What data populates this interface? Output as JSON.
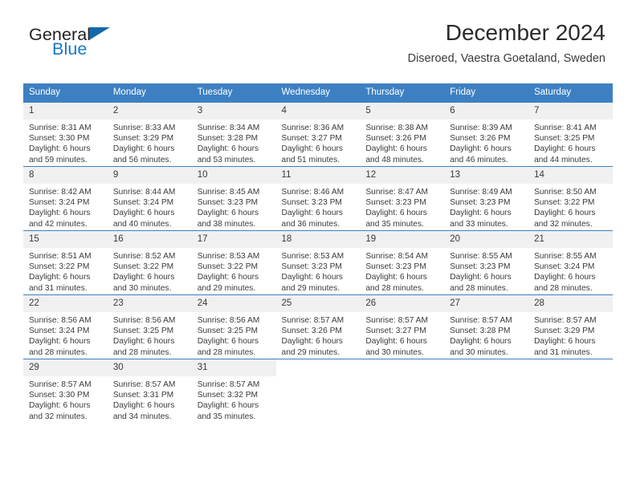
{
  "brand": {
    "name_part1": "General",
    "name_part2": "Blue",
    "triangle_icon": "triangle-icon",
    "accent_color": "#1368ad"
  },
  "header": {
    "title": "December 2024",
    "subtitle": "Diseroed, Vaestra Goetaland, Sweden"
  },
  "theme": {
    "header_bg": "#3d80c2",
    "daynum_bg": "#f0f0f0",
    "text_color": "#3a3a3a",
    "border_color": "#3d80c2"
  },
  "calendar": {
    "weekday_headers": [
      "Sunday",
      "Monday",
      "Tuesday",
      "Wednesday",
      "Thursday",
      "Friday",
      "Saturday"
    ],
    "weeks": [
      [
        {
          "day": "1",
          "sunrise": "Sunrise: 8:31 AM",
          "sunset": "Sunset: 3:30 PM",
          "daylight1": "Daylight: 6 hours",
          "daylight2": "and 59 minutes."
        },
        {
          "day": "2",
          "sunrise": "Sunrise: 8:33 AM",
          "sunset": "Sunset: 3:29 PM",
          "daylight1": "Daylight: 6 hours",
          "daylight2": "and 56 minutes."
        },
        {
          "day": "3",
          "sunrise": "Sunrise: 8:34 AM",
          "sunset": "Sunset: 3:28 PM",
          "daylight1": "Daylight: 6 hours",
          "daylight2": "and 53 minutes."
        },
        {
          "day": "4",
          "sunrise": "Sunrise: 8:36 AM",
          "sunset": "Sunset: 3:27 PM",
          "daylight1": "Daylight: 6 hours",
          "daylight2": "and 51 minutes."
        },
        {
          "day": "5",
          "sunrise": "Sunrise: 8:38 AM",
          "sunset": "Sunset: 3:26 PM",
          "daylight1": "Daylight: 6 hours",
          "daylight2": "and 48 minutes."
        },
        {
          "day": "6",
          "sunrise": "Sunrise: 8:39 AM",
          "sunset": "Sunset: 3:26 PM",
          "daylight1": "Daylight: 6 hours",
          "daylight2": "and 46 minutes."
        },
        {
          "day": "7",
          "sunrise": "Sunrise: 8:41 AM",
          "sunset": "Sunset: 3:25 PM",
          "daylight1": "Daylight: 6 hours",
          "daylight2": "and 44 minutes."
        }
      ],
      [
        {
          "day": "8",
          "sunrise": "Sunrise: 8:42 AM",
          "sunset": "Sunset: 3:24 PM",
          "daylight1": "Daylight: 6 hours",
          "daylight2": "and 42 minutes."
        },
        {
          "day": "9",
          "sunrise": "Sunrise: 8:44 AM",
          "sunset": "Sunset: 3:24 PM",
          "daylight1": "Daylight: 6 hours",
          "daylight2": "and 40 minutes."
        },
        {
          "day": "10",
          "sunrise": "Sunrise: 8:45 AM",
          "sunset": "Sunset: 3:23 PM",
          "daylight1": "Daylight: 6 hours",
          "daylight2": "and 38 minutes."
        },
        {
          "day": "11",
          "sunrise": "Sunrise: 8:46 AM",
          "sunset": "Sunset: 3:23 PM",
          "daylight1": "Daylight: 6 hours",
          "daylight2": "and 36 minutes."
        },
        {
          "day": "12",
          "sunrise": "Sunrise: 8:47 AM",
          "sunset": "Sunset: 3:23 PM",
          "daylight1": "Daylight: 6 hours",
          "daylight2": "and 35 minutes."
        },
        {
          "day": "13",
          "sunrise": "Sunrise: 8:49 AM",
          "sunset": "Sunset: 3:23 PM",
          "daylight1": "Daylight: 6 hours",
          "daylight2": "and 33 minutes."
        },
        {
          "day": "14",
          "sunrise": "Sunrise: 8:50 AM",
          "sunset": "Sunset: 3:22 PM",
          "daylight1": "Daylight: 6 hours",
          "daylight2": "and 32 minutes."
        }
      ],
      [
        {
          "day": "15",
          "sunrise": "Sunrise: 8:51 AM",
          "sunset": "Sunset: 3:22 PM",
          "daylight1": "Daylight: 6 hours",
          "daylight2": "and 31 minutes."
        },
        {
          "day": "16",
          "sunrise": "Sunrise: 8:52 AM",
          "sunset": "Sunset: 3:22 PM",
          "daylight1": "Daylight: 6 hours",
          "daylight2": "and 30 minutes."
        },
        {
          "day": "17",
          "sunrise": "Sunrise: 8:53 AM",
          "sunset": "Sunset: 3:22 PM",
          "daylight1": "Daylight: 6 hours",
          "daylight2": "and 29 minutes."
        },
        {
          "day": "18",
          "sunrise": "Sunrise: 8:53 AM",
          "sunset": "Sunset: 3:23 PM",
          "daylight1": "Daylight: 6 hours",
          "daylight2": "and 29 minutes."
        },
        {
          "day": "19",
          "sunrise": "Sunrise: 8:54 AM",
          "sunset": "Sunset: 3:23 PM",
          "daylight1": "Daylight: 6 hours",
          "daylight2": "and 28 minutes."
        },
        {
          "day": "20",
          "sunrise": "Sunrise: 8:55 AM",
          "sunset": "Sunset: 3:23 PM",
          "daylight1": "Daylight: 6 hours",
          "daylight2": "and 28 minutes."
        },
        {
          "day": "21",
          "sunrise": "Sunrise: 8:55 AM",
          "sunset": "Sunset: 3:24 PM",
          "daylight1": "Daylight: 6 hours",
          "daylight2": "and 28 minutes."
        }
      ],
      [
        {
          "day": "22",
          "sunrise": "Sunrise: 8:56 AM",
          "sunset": "Sunset: 3:24 PM",
          "daylight1": "Daylight: 6 hours",
          "daylight2": "and 28 minutes."
        },
        {
          "day": "23",
          "sunrise": "Sunrise: 8:56 AM",
          "sunset": "Sunset: 3:25 PM",
          "daylight1": "Daylight: 6 hours",
          "daylight2": "and 28 minutes."
        },
        {
          "day": "24",
          "sunrise": "Sunrise: 8:56 AM",
          "sunset": "Sunset: 3:25 PM",
          "daylight1": "Daylight: 6 hours",
          "daylight2": "and 28 minutes."
        },
        {
          "day": "25",
          "sunrise": "Sunrise: 8:57 AM",
          "sunset": "Sunset: 3:26 PM",
          "daylight1": "Daylight: 6 hours",
          "daylight2": "and 29 minutes."
        },
        {
          "day": "26",
          "sunrise": "Sunrise: 8:57 AM",
          "sunset": "Sunset: 3:27 PM",
          "daylight1": "Daylight: 6 hours",
          "daylight2": "and 30 minutes."
        },
        {
          "day": "27",
          "sunrise": "Sunrise: 8:57 AM",
          "sunset": "Sunset: 3:28 PM",
          "daylight1": "Daylight: 6 hours",
          "daylight2": "and 30 minutes."
        },
        {
          "day": "28",
          "sunrise": "Sunrise: 8:57 AM",
          "sunset": "Sunset: 3:29 PM",
          "daylight1": "Daylight: 6 hours",
          "daylight2": "and 31 minutes."
        }
      ],
      [
        {
          "day": "29",
          "sunrise": "Sunrise: 8:57 AM",
          "sunset": "Sunset: 3:30 PM",
          "daylight1": "Daylight: 6 hours",
          "daylight2": "and 32 minutes."
        },
        {
          "day": "30",
          "sunrise": "Sunrise: 8:57 AM",
          "sunset": "Sunset: 3:31 PM",
          "daylight1": "Daylight: 6 hours",
          "daylight2": "and 34 minutes."
        },
        {
          "day": "31",
          "sunrise": "Sunrise: 8:57 AM",
          "sunset": "Sunset: 3:32 PM",
          "daylight1": "Daylight: 6 hours",
          "daylight2": "and 35 minutes."
        },
        {
          "day": "",
          "sunrise": "",
          "sunset": "",
          "daylight1": "",
          "daylight2": ""
        },
        {
          "day": "",
          "sunrise": "",
          "sunset": "",
          "daylight1": "",
          "daylight2": ""
        },
        {
          "day": "",
          "sunrise": "",
          "sunset": "",
          "daylight1": "",
          "daylight2": ""
        },
        {
          "day": "",
          "sunrise": "",
          "sunset": "",
          "daylight1": "",
          "daylight2": ""
        }
      ]
    ]
  }
}
